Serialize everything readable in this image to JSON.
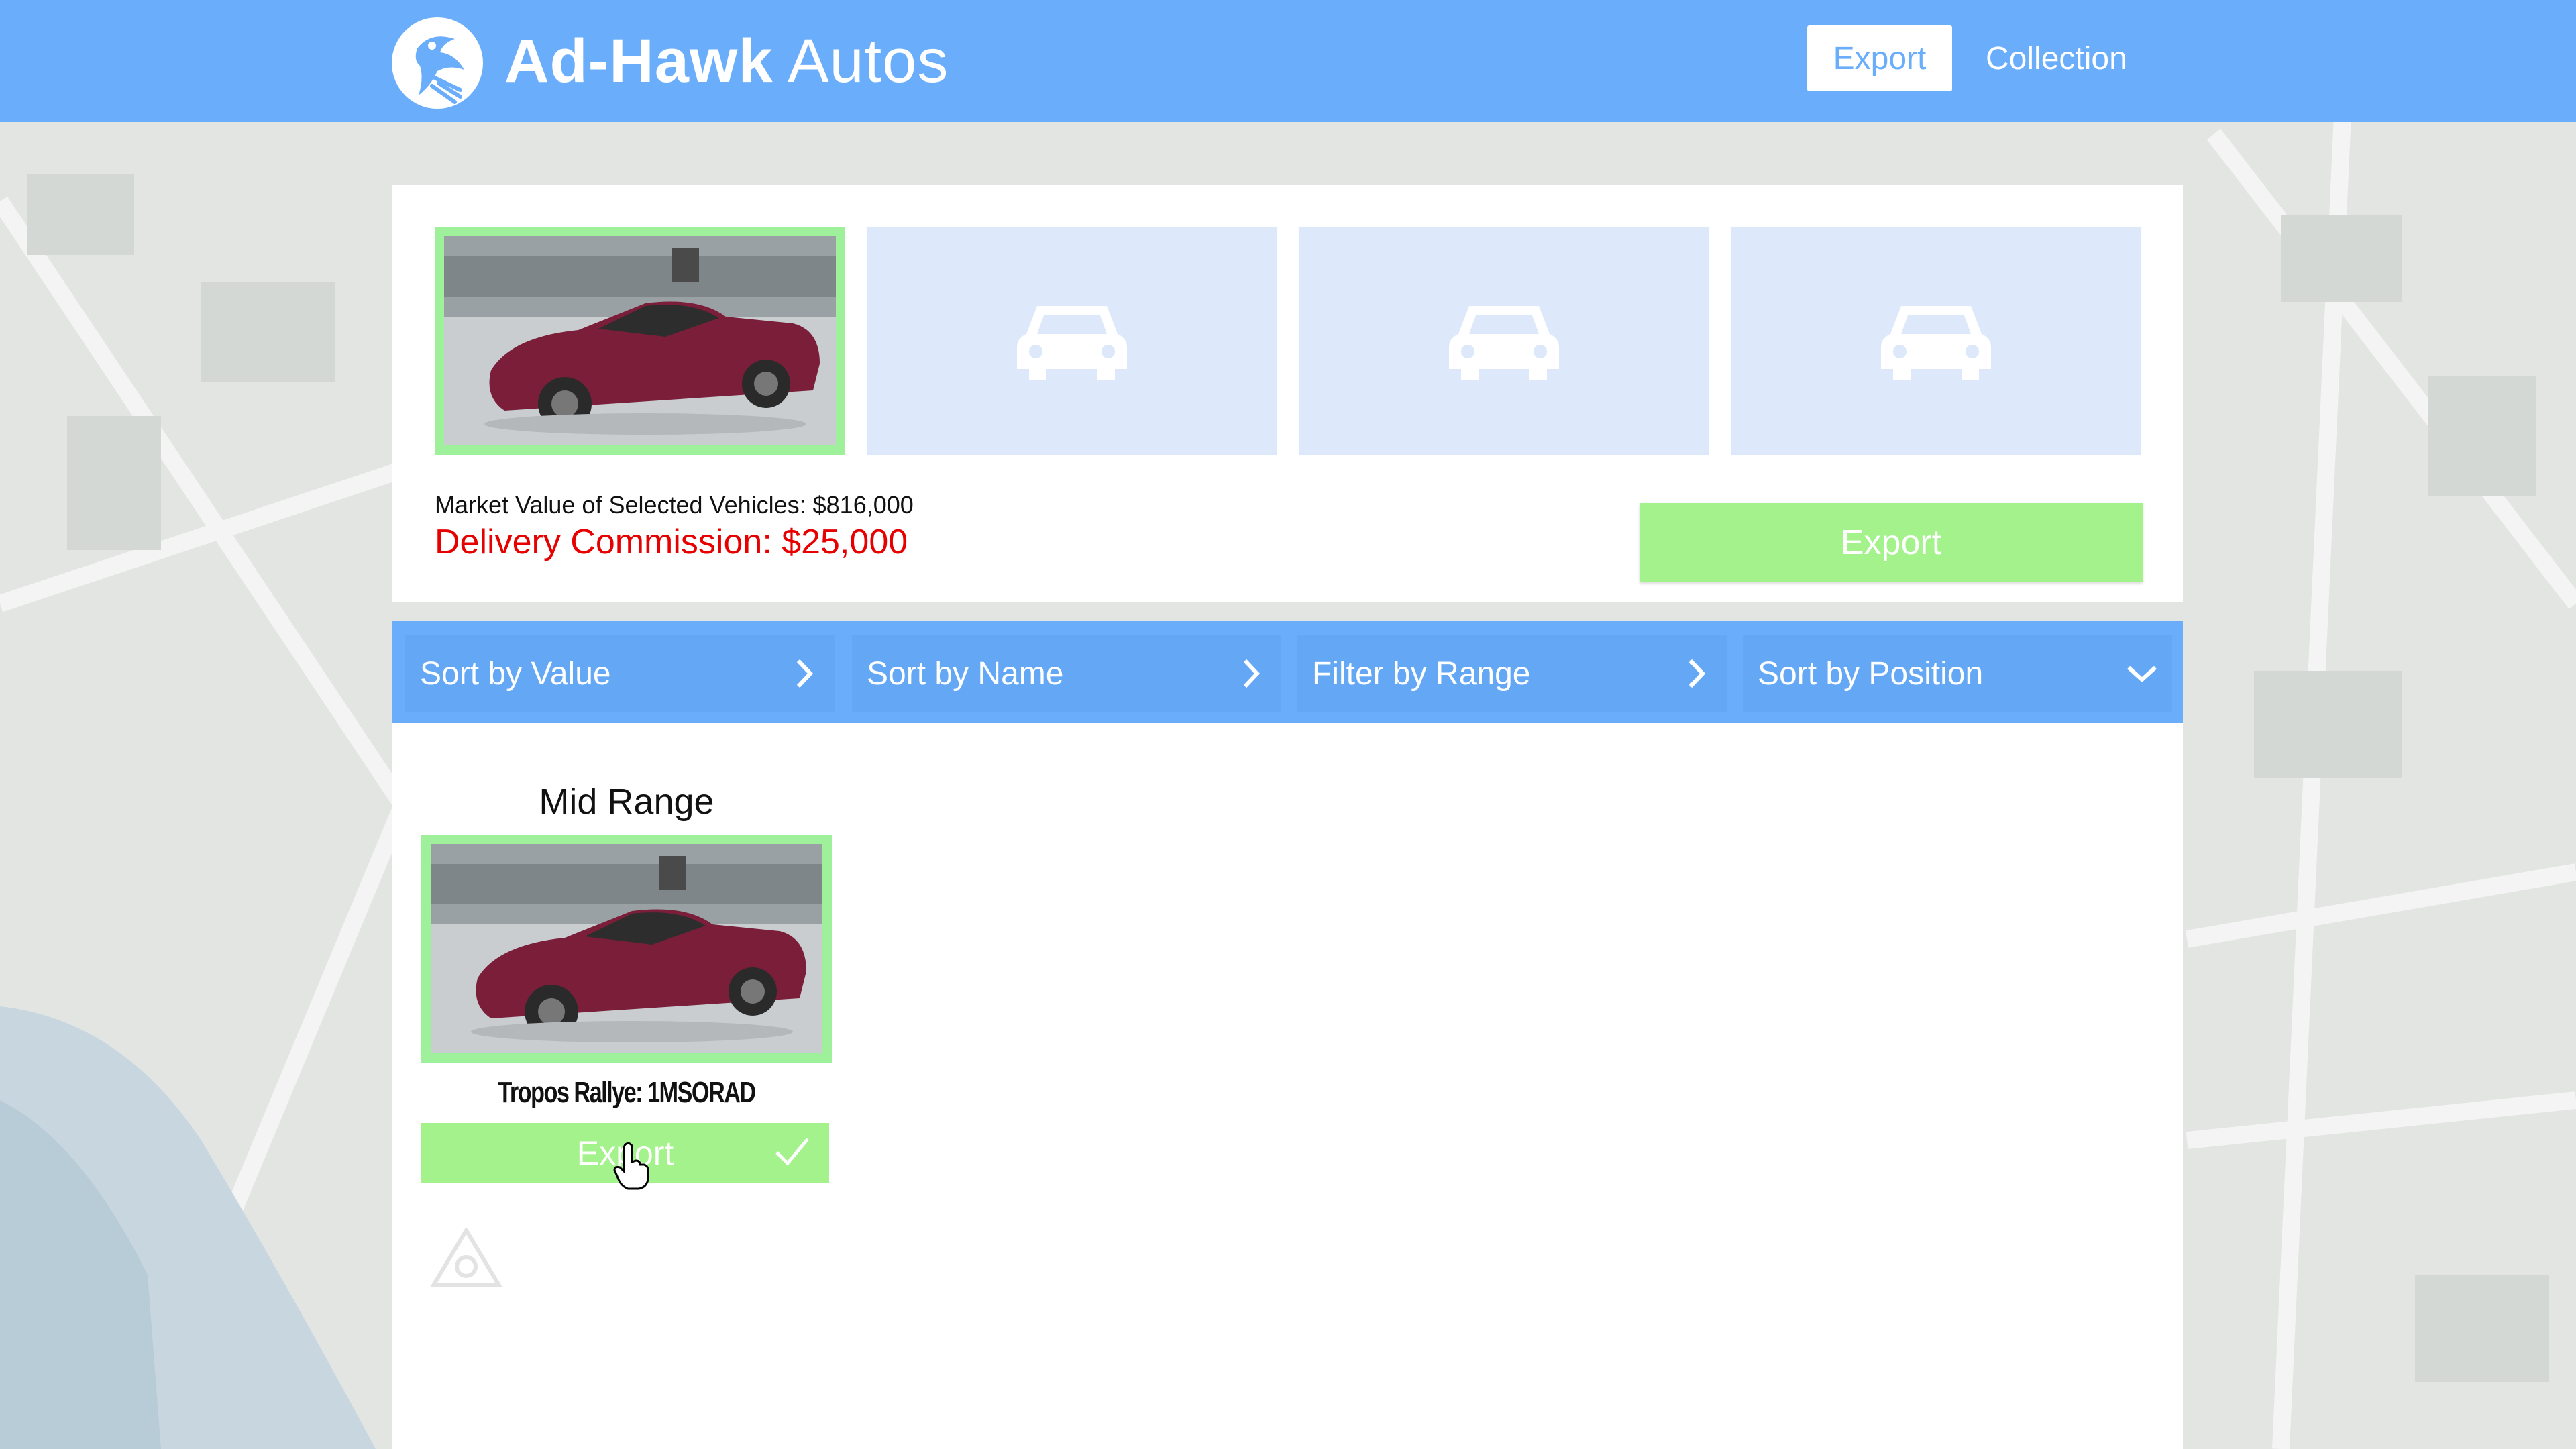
{
  "header": {
    "brand_bold": "Ad-Hawk",
    "brand_light": "Autos",
    "nav": {
      "export_label": "Export",
      "collection_label": "Collection"
    }
  },
  "selection": {
    "slots": [
      {
        "state": "filled",
        "image": "car-photo"
      },
      {
        "state": "empty",
        "icon": "car-icon"
      },
      {
        "state": "empty",
        "icon": "car-icon"
      },
      {
        "state": "empty",
        "icon": "car-icon"
      }
    ],
    "market_value_text": "Market Value of Selected Vehicles: $816,000",
    "commission_text": "Delivery Commission: $25,000",
    "export_label": "Export"
  },
  "filters": [
    {
      "label": "Sort by Value",
      "icon": "chevron-right-icon"
    },
    {
      "label": "Sort by Name",
      "icon": "chevron-right-icon"
    },
    {
      "label": "Filter by Range",
      "icon": "chevron-right-icon"
    },
    {
      "label": "Sort by Position",
      "icon": "chevron-down-icon"
    }
  ],
  "list": {
    "group_title": "Mid Range",
    "vehicles": [
      {
        "name": "Tropos Rallye: 1MSORAD",
        "export_label": "Export",
        "selected": true
      }
    ]
  },
  "colors": {
    "header_blue": "#6aaefb",
    "selected_green": "#9ff09a",
    "export_green": "#a4f28c",
    "commission_red": "#e60000",
    "empty_slot": "#dde8fb"
  }
}
